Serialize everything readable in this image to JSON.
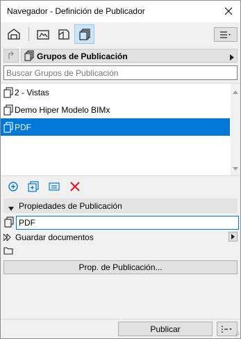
{
  "window": {
    "title": "Navegador - Definición de Publicador"
  },
  "tabs": [
    {
      "icon": "project-map-icon",
      "active": false
    },
    {
      "icon": "view-map-icon",
      "active": false
    },
    {
      "icon": "layout-book-icon",
      "active": false
    },
    {
      "icon": "publisher-sets-icon",
      "active": true
    }
  ],
  "set_selector": {
    "label": "Grupos de Publicación"
  },
  "search": {
    "placeholder": "Buscar Grupos de Publicación"
  },
  "list": {
    "items": [
      {
        "label": "2 - Vistas",
        "selected": false
      },
      {
        "label": "Demo Hiper Modelo BIMx",
        "selected": false
      },
      {
        "label": "PDF",
        "selected": true
      }
    ]
  },
  "actions": [
    {
      "icon": "add-icon"
    },
    {
      "icon": "new-folder-icon"
    },
    {
      "icon": "settings-icon"
    },
    {
      "icon": "delete-icon"
    }
  ],
  "properties": {
    "header": "Propiedades de Publicación",
    "name_value": "PDF",
    "save_label": "Guardar documentos",
    "button_label": "Prop. de Publicación..."
  },
  "footer": {
    "publish_label": "Publicar"
  },
  "colors": {
    "selection": "#0078d7",
    "delete": "#e81123",
    "accent": "#0078d7"
  }
}
